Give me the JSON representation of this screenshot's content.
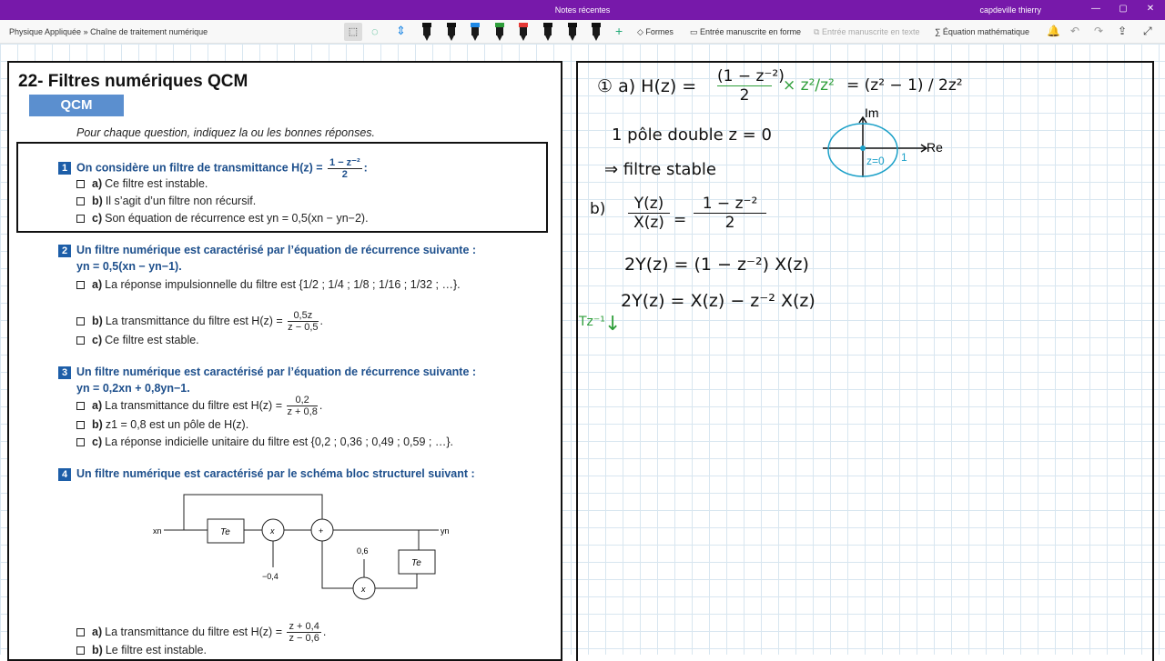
{
  "window": {
    "title": "Notes récentes",
    "user": "capdeville thierry"
  },
  "toolbar": {
    "breadcrumb": "Physique Appliquée » Chaîne de traitement numérique",
    "formes": "Formes",
    "entree_forme": "Entrée manuscrite en forme",
    "entree_texte": "Entrée manuscrite en texte",
    "equation": "Équation mathématique",
    "pen_colors": [
      "#111111",
      "#111111",
      "#1e88e5",
      "#2e9e3a",
      "#e53935",
      "#111111",
      "#111111",
      "#111111"
    ]
  },
  "doc": {
    "title": "22- Filtres numériques QCM",
    "badge": "QCM",
    "intro": "Pour chaque question, indiquez la ou les bonnes réponses.",
    "q1": {
      "num": "1",
      "text": "On considère un filtre de transmittance H(z) =",
      "frac_n": "1 − z⁻²",
      "frac_d": "2",
      "a": "Ce filtre est instable.",
      "b": "Il s’agit d’un filtre non récursif.",
      "c": "Son équation de récurrence est yn = 0,5(xn − yn−2)."
    },
    "q2": {
      "num": "2",
      "text": "Un filtre numérique est caractérisé par l’équation de récurrence suivante :",
      "text2": "yn = 0,5(xn − yn−1).",
      "a": "La réponse impulsionnelle du filtre est {1/2 ; 1/4 ; 1/8 ; 1/16 ; 1/32 ; …}.",
      "b": "La transmittance du filtre est H(z) =",
      "b_n": "0,5z",
      "b_d": "z − 0,5",
      "c": "Ce filtre est stable."
    },
    "q3": {
      "num": "3",
      "text": "Un filtre numérique est caractérisé par l’équation de récurrence suivante :",
      "text2": "yn = 0,2xn + 0,8yn−1.",
      "a": "La transmittance du filtre est H(z) =",
      "a_n": "0,2",
      "a_d": "z + 0,8",
      "b": "z1 = 0,8 est un pôle de H(z).",
      "c": "La réponse indicielle unitaire du filtre est {0,2 ; 0,36 ; 0,49 ; 0,59 ; …}."
    },
    "q4": {
      "num": "4",
      "text": "Un filtre numérique est caractérisé par le schéma bloc structurel suivant :",
      "diagram": {
        "xn": "xn",
        "yn": "yn",
        "te": "Te",
        "mult": "x",
        "sum": "+",
        "g1": "−0,4",
        "g2": "0,6"
      },
      "a": "La transmittance du filtre est H(z) =",
      "a_n": "z + 0,4",
      "a_d": "z − 0,6",
      "b": "Le filtre est instable."
    }
  },
  "handwriting": {
    "l1": "① a) H(z) =",
    "l1_frac_n": "(1 − z⁻²)",
    "l1_frac_d": "2",
    "l1_mul": "× z²/z²",
    "l1_eq": "= (z² − 1) / 2z²",
    "l2": "1 pôle double  z = 0",
    "l3": "⇒ filtre stable",
    "im": "Im",
    "re": "Re",
    "z0": "z=0",
    "one": "1",
    "b": "b)",
    "b_lhs_n": "Y(z)",
    "b_lhs_d": "X(z)",
    "b_rhs_n": "1 − z⁻²",
    "b_rhs_d": "2",
    "b2": "2Y(z) = (1 − z⁻²) X(z)",
    "b3": "2Y(z) = X(z) − z⁻² X(z)",
    "tz": "Tz⁻¹"
  }
}
